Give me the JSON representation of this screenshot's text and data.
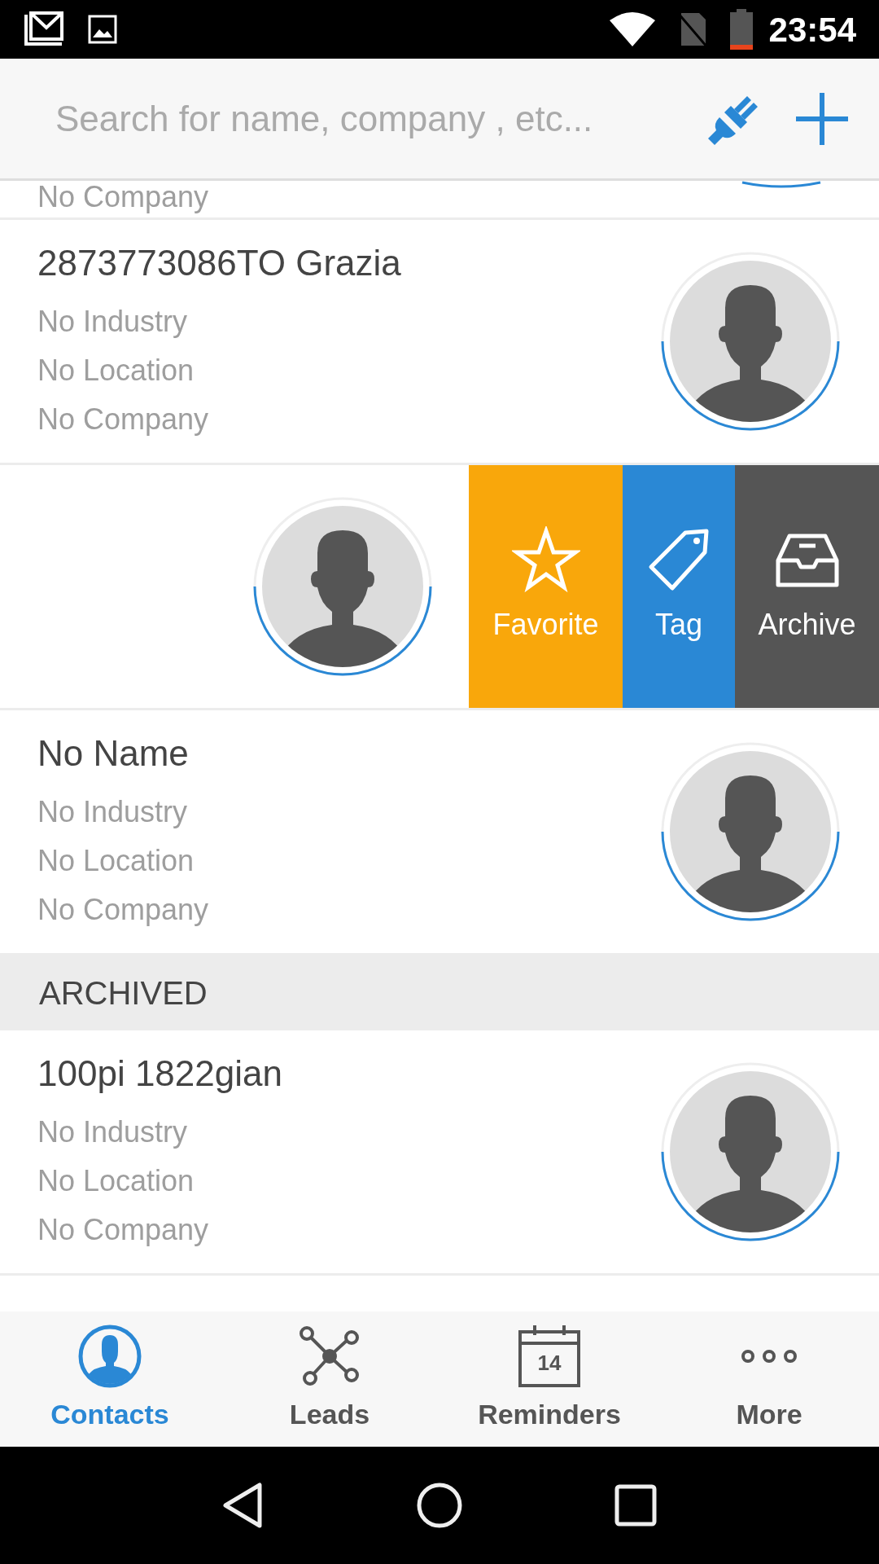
{
  "status_bar": {
    "time": "23:54"
  },
  "search": {
    "placeholder": "Search for name, company , etc..."
  },
  "list": [
    {
      "kind": "clipped",
      "company": "No Company"
    },
    {
      "kind": "contact",
      "name": "2873773086TO Grazia",
      "industry": "No Industry",
      "location": "No Location",
      "company": "No Company"
    },
    {
      "kind": "swiped",
      "actions": [
        {
          "kind": "favorite",
          "label": "Favorite",
          "color": "#f9a70b"
        },
        {
          "kind": "tag",
          "label": "Tag",
          "color": "#2a88d5"
        },
        {
          "kind": "archive",
          "label": "Archive",
          "color": "#555555"
        }
      ]
    },
    {
      "kind": "contact",
      "name": "No Name",
      "industry": "No Industry",
      "location": "No Location",
      "company": "No Company"
    },
    {
      "kind": "header",
      "label": "ARCHIVED"
    },
    {
      "kind": "contact",
      "name": "100pi 1822gian",
      "industry": "No Industry",
      "location": "No Location",
      "company": "No Company"
    }
  ],
  "nav": [
    {
      "kind": "contacts",
      "label": "Contacts",
      "selected": true
    },
    {
      "kind": "leads",
      "label": "Leads",
      "selected": false
    },
    {
      "kind": "reminders",
      "label": "Reminders",
      "icon_text": "14",
      "selected": false
    },
    {
      "kind": "more",
      "label": "More",
      "selected": false
    }
  ]
}
